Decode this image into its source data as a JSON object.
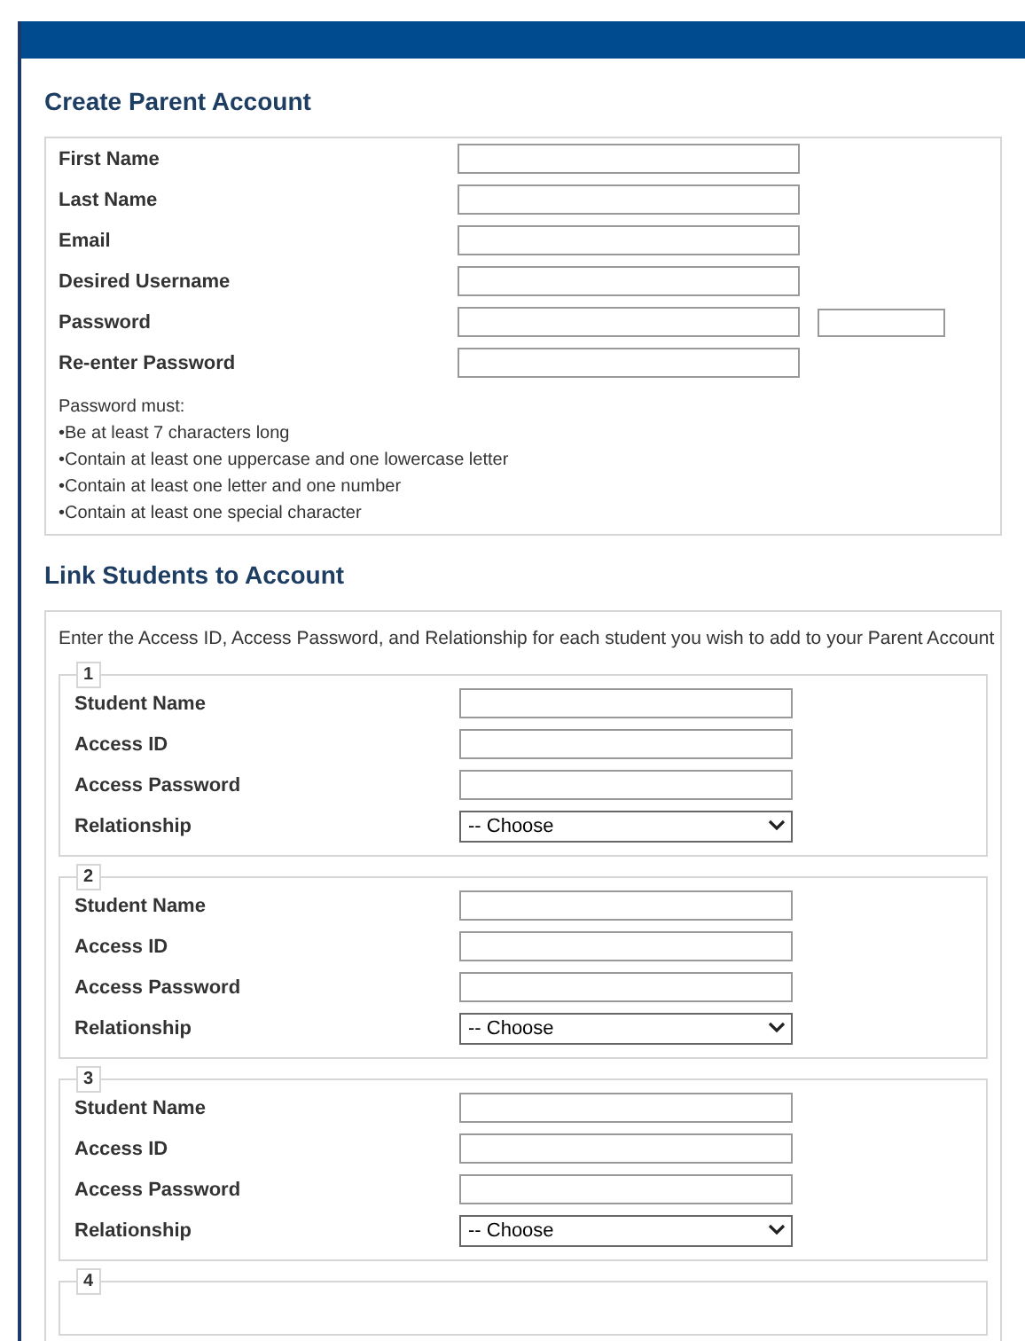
{
  "sections": [
    {
      "title": "Create Parent Account"
    },
    {
      "title": "Link Students to Account"
    }
  ],
  "parent_fields": [
    {
      "label": "First Name",
      "extra_field": false
    },
    {
      "label": "Last Name",
      "extra_field": false
    },
    {
      "label": "Email",
      "extra_field": false
    },
    {
      "label": "Desired Username",
      "extra_field": false
    },
    {
      "label": "Password",
      "extra_field": true
    },
    {
      "label": "Re-enter Password",
      "extra_field": false
    }
  ],
  "password_rules": [
    "Password must:",
    "•Be at least 7 characters long",
    "•Contain at least one uppercase and one lowercase letter",
    "•Contain at least one letter and one number",
    "•Contain at least one special character"
  ],
  "link_intro": "Enter the Access ID, Access Password, and Relationship for each student you wish to add to your Parent Account",
  "students": [
    {
      "number": "1",
      "fields": [
        {
          "kind": "text",
          "label": "Student Name"
        },
        {
          "kind": "text",
          "label": "Access ID"
        },
        {
          "kind": "text",
          "label": "Access Password"
        },
        {
          "kind": "select",
          "label": "Relationship",
          "value": "-- Choose"
        }
      ]
    },
    {
      "number": "2",
      "fields": [
        {
          "kind": "text",
          "label": "Student Name"
        },
        {
          "kind": "text",
          "label": "Access ID"
        },
        {
          "kind": "text",
          "label": "Access Password"
        },
        {
          "kind": "select",
          "label": "Relationship",
          "value": "-- Choose"
        }
      ]
    },
    {
      "number": "3",
      "fields": [
        {
          "kind": "text",
          "label": "Student Name"
        },
        {
          "kind": "text",
          "label": "Access ID"
        },
        {
          "kind": "text",
          "label": "Access Password"
        },
        {
          "kind": "select",
          "label": "Relationship",
          "value": "-- Choose"
        }
      ]
    },
    {
      "number": "4"
    }
  ]
}
